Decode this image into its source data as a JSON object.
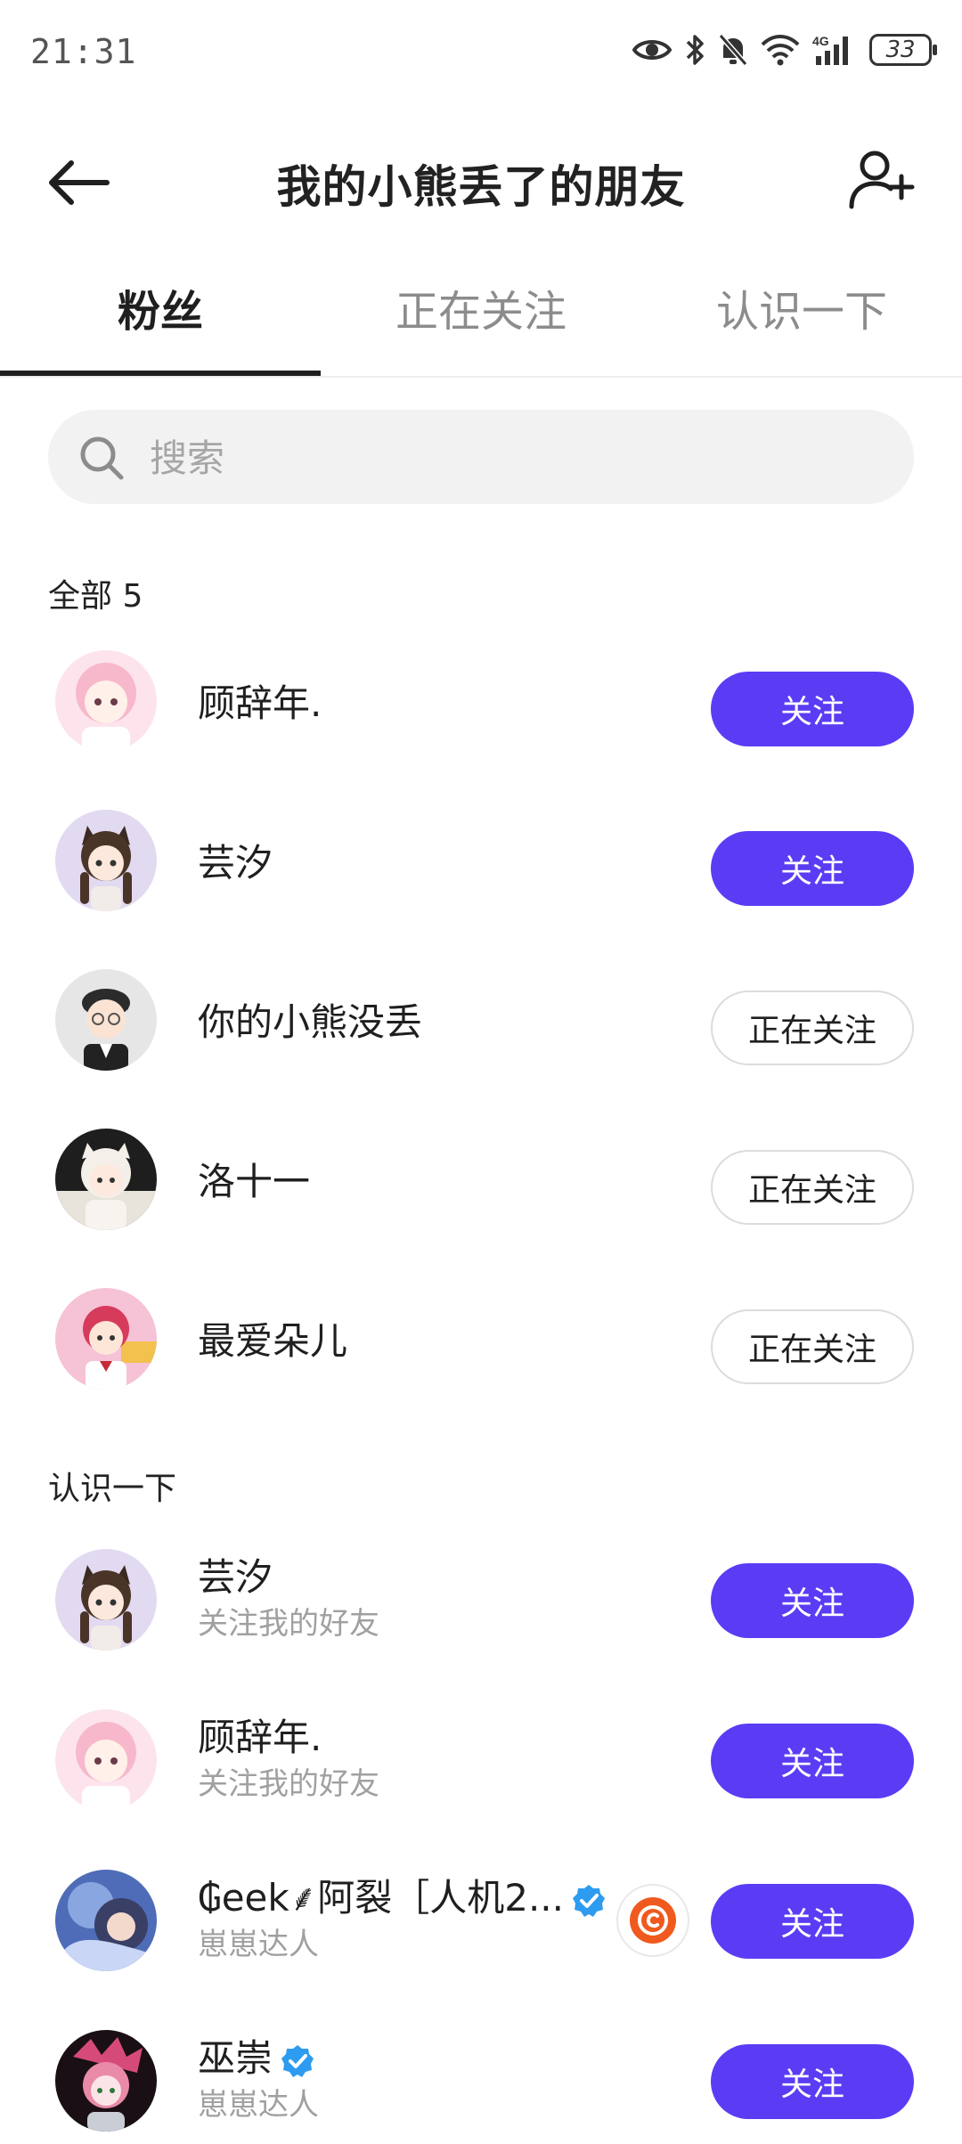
{
  "status_bar": {
    "time": "21:31",
    "battery": "33",
    "network": "4G"
  },
  "header": {
    "title": "我的小熊丢了的朋友"
  },
  "tabs": [
    {
      "label": "粉丝",
      "active": true
    },
    {
      "label": "正在关注",
      "active": false
    },
    {
      "label": "认识一下",
      "active": false
    }
  ],
  "search": {
    "placeholder": "搜索"
  },
  "fans_section": {
    "label": "全部 5",
    "items": [
      {
        "name": "顾辞年.",
        "button": "关注",
        "button_style": "primary",
        "avatar_color": "#f7c6d6"
      },
      {
        "name": "芸汐",
        "button": "关注",
        "button_style": "primary",
        "avatar_color": "#d8cde8"
      },
      {
        "name": "你的小熊没丢",
        "button": "正在关注",
        "button_style": "secondary",
        "avatar_color": "#dcdcdc"
      },
      {
        "name": "洛十一",
        "button": "正在关注",
        "button_style": "secondary",
        "avatar_color": "#2a2a2a"
      },
      {
        "name": "最爱朵儿",
        "button": "正在关注",
        "button_style": "secondary",
        "avatar_color": "#f2a9c6"
      }
    ]
  },
  "suggest_section": {
    "label": "认识一下",
    "items": [
      {
        "name": "芸汐",
        "sub": "关注我的好友",
        "button": "关注",
        "avatar_color": "#d8cde8"
      },
      {
        "name": "顾辞年.",
        "sub": "关注我的好友",
        "button": "关注",
        "avatar_color": "#f7c6d6"
      },
      {
        "name": "₲eek⸙阿裂［人机2...",
        "sub": "崽崽达人",
        "button": "关注",
        "verified": true,
        "avatar_color": "#6a86c9"
      },
      {
        "name": "巫崇",
        "sub": "崽崽达人",
        "button": "关注",
        "verified": true,
        "avatar_color": "#3a1f2a"
      }
    ]
  },
  "colors": {
    "accent": "#5b3cf4",
    "verified": "#2d9cf0",
    "badge": "#f05a1e"
  }
}
